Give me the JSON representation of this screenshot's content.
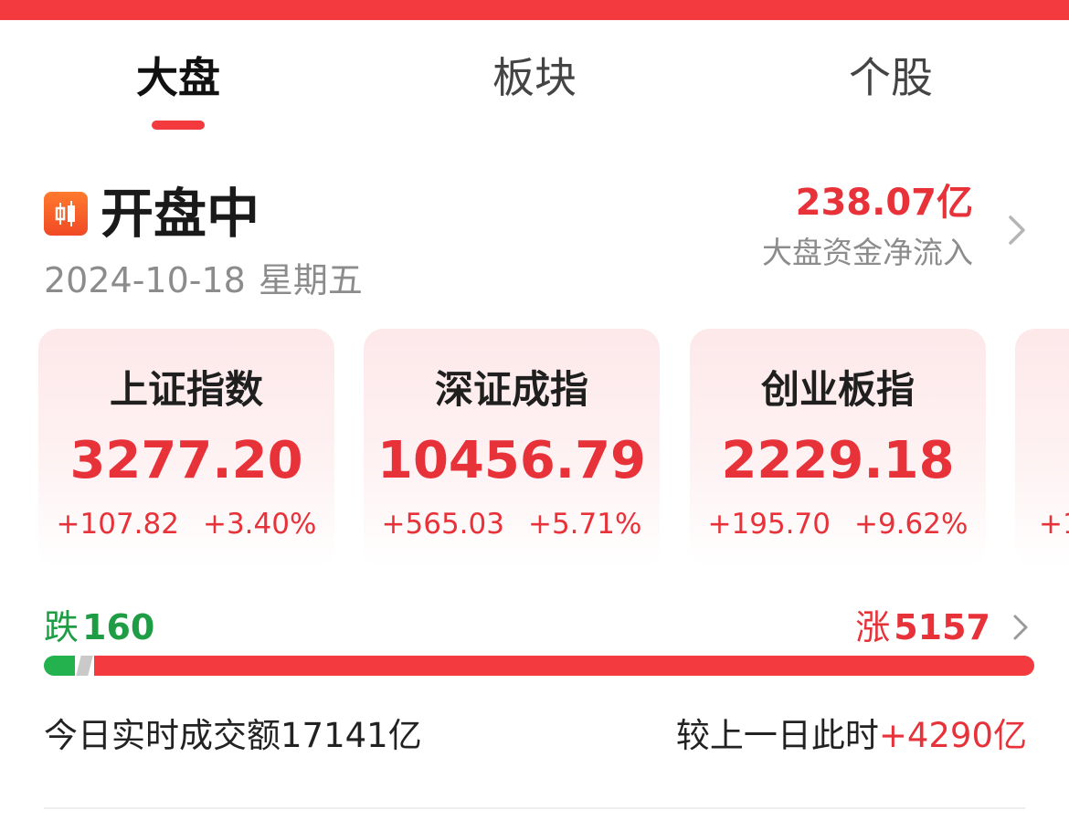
{
  "tabs": [
    {
      "label": "大盘",
      "active": true
    },
    {
      "label": "板块",
      "active": false
    },
    {
      "label": "个股",
      "active": false
    }
  ],
  "market": {
    "status": "开盘中",
    "date": "2024-10-18",
    "weekday": "星期五",
    "net_inflow_value": "238.07亿",
    "net_inflow_label": "大盘资金净流入"
  },
  "indices": [
    {
      "name": "上证指数",
      "value": "3277.20",
      "change": "+107.82",
      "change_pct": "+3.40%"
    },
    {
      "name": "深证成指",
      "value": "10456.79",
      "change": "+565.03",
      "change_pct": "+5.71%"
    },
    {
      "name": "创业板指",
      "value": "2229.18",
      "change": "+195.70",
      "change_pct": "+9.62%"
    },
    {
      "name": "",
      "value": "",
      "change": "+1",
      "change_pct": ""
    }
  ],
  "breadth": {
    "fall_label": "跌",
    "fall_count": "160",
    "rise_label": "涨",
    "rise_count": "5157",
    "fall_fraction": 0.031,
    "flat_fraction": 0.012
  },
  "turnover": {
    "text": "今日实时成交额17141亿",
    "compare_label": "较上一日此时",
    "compare_delta": "+4290亿"
  },
  "colors": {
    "up": "#e8323a",
    "down": "#1f9d45",
    "accent": "#f23a3f"
  },
  "icons": {
    "status": "candlestick-icon",
    "flow_link": "chevron-right-icon",
    "breadth_link": "chevron-right-icon"
  }
}
